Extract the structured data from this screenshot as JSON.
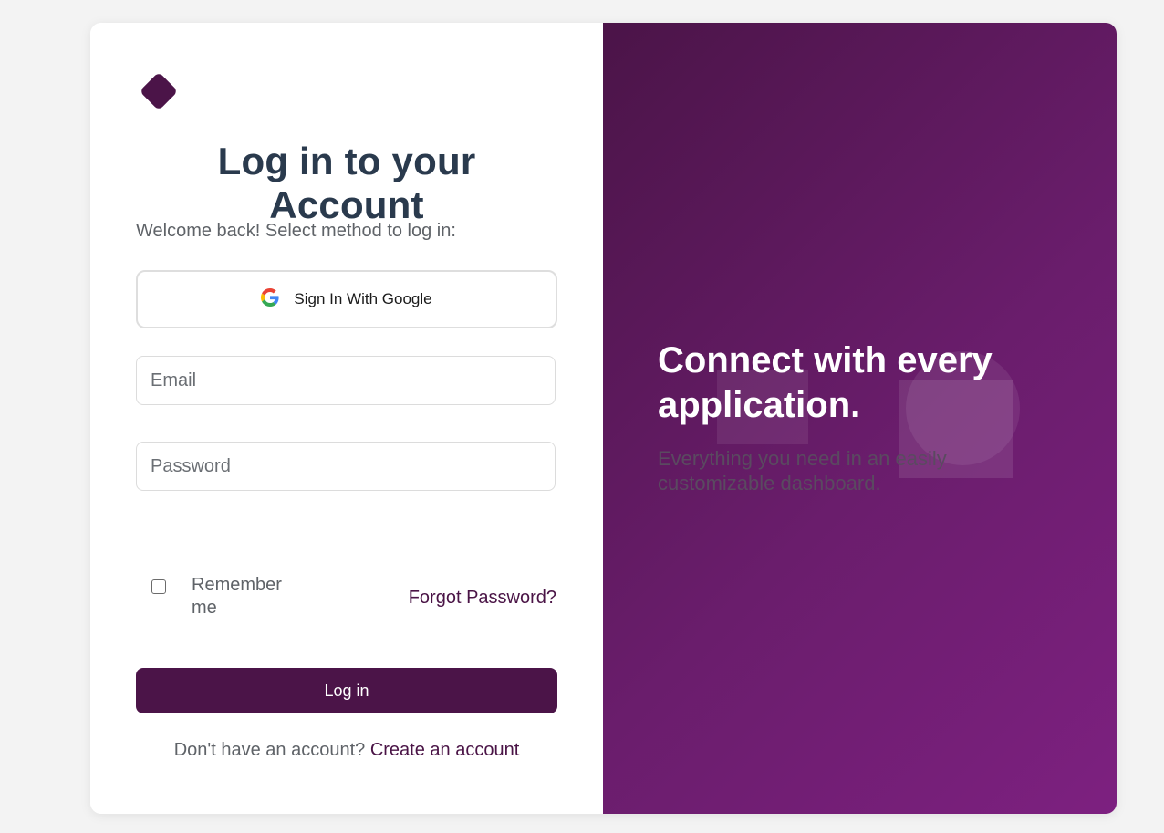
{
  "login": {
    "title": "Log in to your Account",
    "subtitle": "Welcome back! Select method to log in:",
    "google_button": "Sign In With Google",
    "email_placeholder": "Email",
    "password_placeholder": "Password",
    "remember_label": "Remember me",
    "forgot_link": "Forgot Password?",
    "login_button": "Log in",
    "signup_prompt": "Don't have an account?",
    "signup_link": "Create an account"
  },
  "promo": {
    "title": "Connect with every application.",
    "subtitle": "Everything you need in an easily customizable dashboard."
  },
  "colors": {
    "brand": "#4b1448",
    "gradient_end": "#7d2080",
    "title_text": "#2a3a4d"
  },
  "icons": {
    "logo": "diamond-logo-icon",
    "google": "google-g-icon",
    "checkbox": "checkbox-unchecked"
  }
}
